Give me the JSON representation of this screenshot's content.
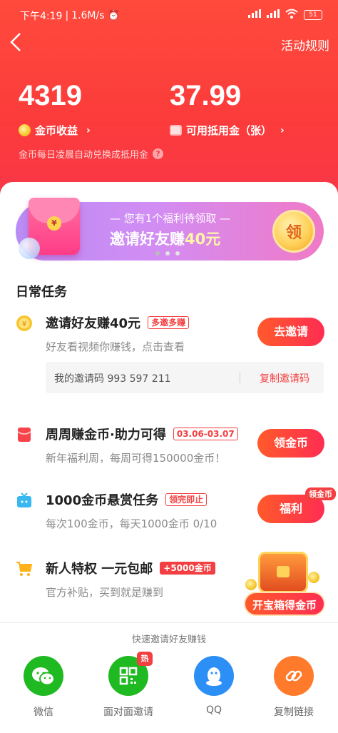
{
  "status_bar": {
    "time": "下午4:19",
    "speed": "1.6M/s",
    "battery": "51"
  },
  "topbar": {
    "back_symbol": "<",
    "rules_label": "活动规则"
  },
  "stats": {
    "coins_value": "4319",
    "coins_label": "金币收益",
    "vouchers_value": "37.99",
    "vouchers_label": "可用抵用金（张）",
    "chevron": "›",
    "note": "金币每日凌晨自动兑换成抵用金"
  },
  "banner": {
    "sub": "— 您有1个福利待领取 —",
    "main_prefix": "邀请好友赚",
    "main_amount": "40元",
    "claim_label": "领",
    "seal": "¥",
    "page_count": 3,
    "active_page": 0
  },
  "daily_tasks_title": "日常任务",
  "tasks": [
    {
      "title": "邀请好友赚40元",
      "tag": "多邀多赚",
      "desc": "好友看视频你赚钱，点击查看",
      "button": "去邀请"
    },
    {
      "title": "周周赚金币·助力可得",
      "tag": "03.06-03.07",
      "desc": "新年福利周，每周可得150000金币！",
      "button": "领金币"
    },
    {
      "title": "1000金币悬赏任务",
      "tag": "领完即止",
      "desc": "每次100金币，每天1000金币 0/10",
      "button": "福利"
    },
    {
      "title": "新人特权 一元包邮",
      "tag": "+5000金币",
      "desc": "官方补贴，买到就是赚到"
    }
  ],
  "invite_code": {
    "text": "我的邀请码 993 597 211",
    "copy_label": "复制邀请码"
  },
  "coin_badge": "领金币",
  "chest_label": "开宝箱得金币",
  "share": {
    "hint": "快速邀请好友赚钱",
    "items": [
      {
        "label": "微信",
        "color": "#1fb922"
      },
      {
        "label": "面对面邀请",
        "color": "#1fb922",
        "badge": "热"
      },
      {
        "label": "QQ",
        "color": "#2b8ff5"
      },
      {
        "label": "复制链接",
        "color": "#ff7a2a"
      }
    ]
  },
  "colors": {
    "accent": "#f33f41",
    "header": "#fb3b3b",
    "button_gradient": [
      "#ff5a2b",
      "#ff2d52"
    ]
  }
}
